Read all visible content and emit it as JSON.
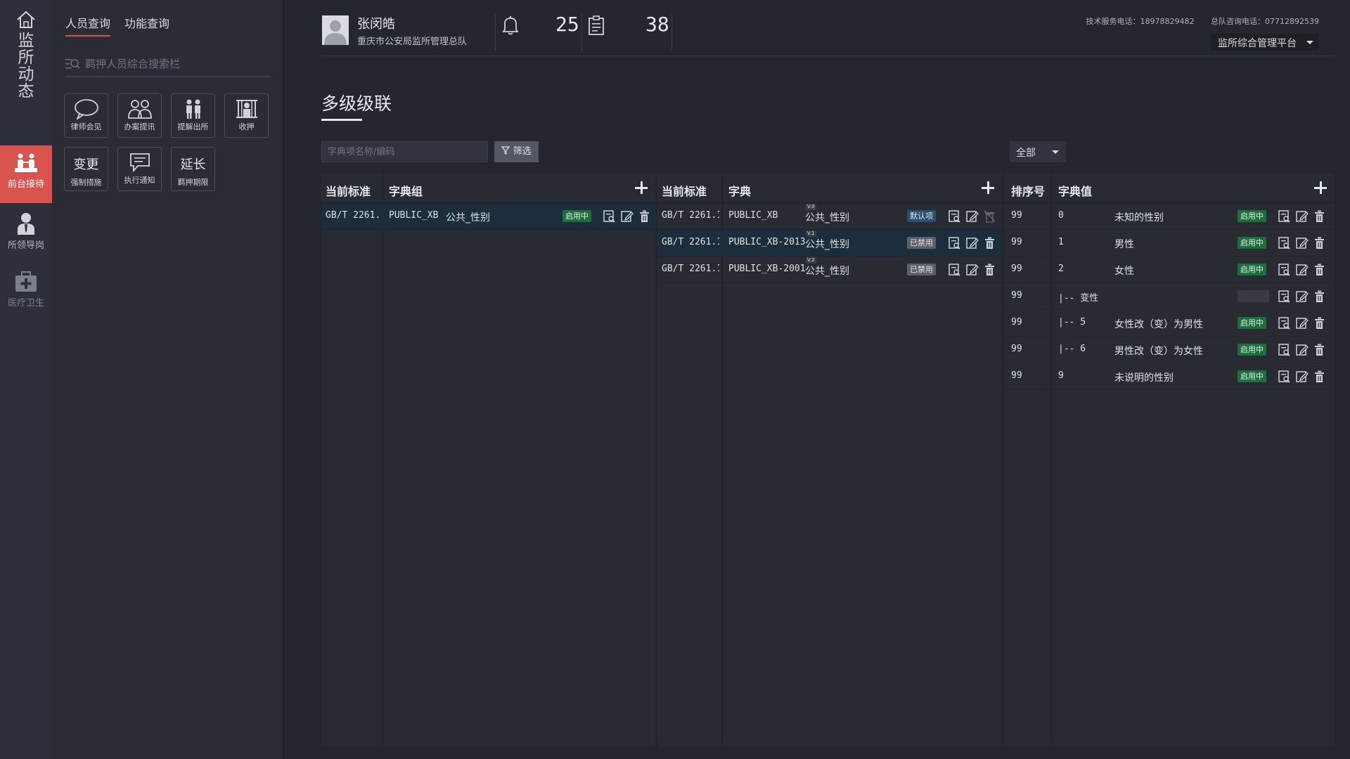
{
  "leftnav": {
    "home_vertical": "监所动态",
    "items": [
      {
        "label": "前台接待",
        "icon": "reception-icon",
        "active": true
      },
      {
        "label": "所领导岗",
        "icon": "leader-icon",
        "active": false
      },
      {
        "label": "医疗卫生",
        "icon": "medical-kit-icon",
        "active": false
      }
    ]
  },
  "subpanel": {
    "tabs": [
      {
        "label": "人员查询"
      },
      {
        "label": "功能查询"
      }
    ],
    "search_placeholder": "羁押人员综合搜索栏",
    "functions": [
      {
        "label": "律师会见",
        "icon": "chat-bubble-icon"
      },
      {
        "label": "办案提讯",
        "icon": "interrogation-icon"
      },
      {
        "label": "提解出所",
        "icon": "escort-out-icon"
      },
      {
        "label": "收押",
        "icon": "detention-icon"
      },
      {
        "label": "强制措施",
        "big": "变更"
      },
      {
        "label": "执行通知",
        "icon": "notice-icon"
      },
      {
        "label": "羁押期限",
        "big": "延长"
      }
    ]
  },
  "header": {
    "user_name": "张闵皓",
    "org": "重庆市公安局监所管理总队",
    "count_alerts": "25",
    "count_tasks": "38",
    "tech_phone": "技术服务电话：18978829482",
    "consult_phone": "总队咨询电话：07712892539",
    "platform": "监所综合管理平台"
  },
  "page": {
    "title": "多级级联",
    "filter_placeholder": "字典项名称/编码",
    "filter_button": "筛选",
    "select_value": "全部"
  },
  "panel1": {
    "headers": {
      "std": "当前标准",
      "group": "字典组"
    },
    "rows": [
      {
        "std": "GB/T 2261.1...",
        "code": "PUBLIC_XB",
        "name": "公共_性别",
        "status": "启用中"
      }
    ]
  },
  "panel2": {
    "headers": {
      "std": "当前标准",
      "dict": "字典"
    },
    "rows": [
      {
        "std": "GB/T 2261.1...",
        "code": "PUBLIC_XB",
        "ver": "V.0",
        "name": "公共_性别",
        "status": "默认项",
        "kind": "def"
      },
      {
        "std": "GB/T 2261.1...",
        "code": "PUBLIC_XB-2013",
        "ver": "V.1",
        "name": "公共_性别",
        "status": "已禁用",
        "kind": "off"
      },
      {
        "std": "GB/T 2261.1...",
        "code": "PUBLIC_XB-2001",
        "ver": "V.2",
        "name": "公共_性别",
        "status": "已禁用",
        "kind": "off"
      }
    ]
  },
  "panel3": {
    "headers": {
      "order": "排序号",
      "value": "字典值"
    },
    "rows": [
      {
        "order": "99",
        "code": "0",
        "name": "未知的性别",
        "status": "启用中"
      },
      {
        "order": "99",
        "code": "1",
        "name": "男性",
        "status": "启用中"
      },
      {
        "order": "99",
        "code": "2",
        "name": "女性",
        "status": "启用中"
      },
      {
        "order": "99",
        "code": "|-- 变性",
        "name": "",
        "status": ""
      },
      {
        "order": "99",
        "code": "|-- 5",
        "name": "女性改（变）为男性",
        "status": "启用中"
      },
      {
        "order": "99",
        "code": "|-- 6",
        "name": "男性改（变）为女性",
        "status": "启用中"
      },
      {
        "order": "99",
        "code": "9",
        "name": "未说明的性别",
        "status": "启用中"
      }
    ]
  }
}
